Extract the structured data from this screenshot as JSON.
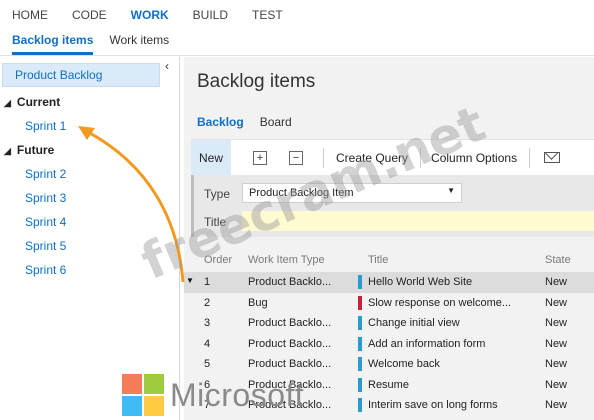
{
  "topnav": {
    "items": [
      {
        "label": "HOME"
      },
      {
        "label": "CODE"
      },
      {
        "label": "WORK"
      },
      {
        "label": "BUILD"
      },
      {
        "label": "TEST"
      }
    ],
    "active": "WORK"
  },
  "subnav": {
    "items": [
      {
        "label": "Backlog items"
      },
      {
        "label": "Work items"
      }
    ],
    "active": "Backlog items"
  },
  "sidebar": {
    "collapse_icon": "chevron-left-icon",
    "selected": "Product Backlog",
    "current_label": "Current",
    "current_items": [
      "Sprint 1"
    ],
    "future_label": "Future",
    "future_items": [
      "Sprint 2",
      "Sprint 3",
      "Sprint 4",
      "Sprint 5",
      "Sprint 6"
    ]
  },
  "main": {
    "title": "Backlog items",
    "tabs": [
      {
        "label": "Backlog"
      },
      {
        "label": "Board"
      }
    ],
    "active_tab": "Backlog"
  },
  "toolbar": {
    "new_label": "New",
    "expand_icon": "plus-box-icon",
    "collapse_icon": "minus-box-icon",
    "create_query_label": "Create Query",
    "column_options_label": "Column Options",
    "email_icon": "envelope-icon"
  },
  "form": {
    "type_label": "Type",
    "type_value": "Product Backlog Item",
    "title_label": "Title",
    "title_value": ""
  },
  "grid": {
    "headers": {
      "order": "Order",
      "type": "Work Item Type",
      "title": "Title",
      "state": "State"
    },
    "rows": [
      {
        "order": "1",
        "type": "Product Backlo...",
        "title": "Hello World Web Site",
        "state": "New",
        "color": "#2a9bd0"
      },
      {
        "order": "2",
        "type": "Bug",
        "title": "Slow response on welcome...",
        "state": "New",
        "color": "#c4243d"
      },
      {
        "order": "3",
        "type": "Product Backlo...",
        "title": "Change initial view",
        "state": "New",
        "color": "#2a9bd0"
      },
      {
        "order": "4",
        "type": "Product Backlo...",
        "title": "Add an information form",
        "state": "New",
        "color": "#2a9bd0"
      },
      {
        "order": "5",
        "type": "Product Backlo...",
        "title": "Welcome back",
        "state": "New",
        "color": "#2a9bd0"
      },
      {
        "order": "6",
        "type": "Product Backlo...",
        "title": "Resume",
        "state": "New",
        "color": "#2a9bd0"
      },
      {
        "order": "7",
        "type": "Product Backlo...",
        "title": "Interim save on long forms",
        "state": "New",
        "color": "#2a9bd0"
      }
    ],
    "selected_row": 1
  },
  "watermark": "freecram.net",
  "brand": {
    "logo_text": "Microsoft",
    "logo_colors": [
      "#f25022",
      "#7fba00",
      "#00a4ef",
      "#ffb900"
    ]
  },
  "annotation": {
    "arrow_color": "#f29a1f"
  }
}
